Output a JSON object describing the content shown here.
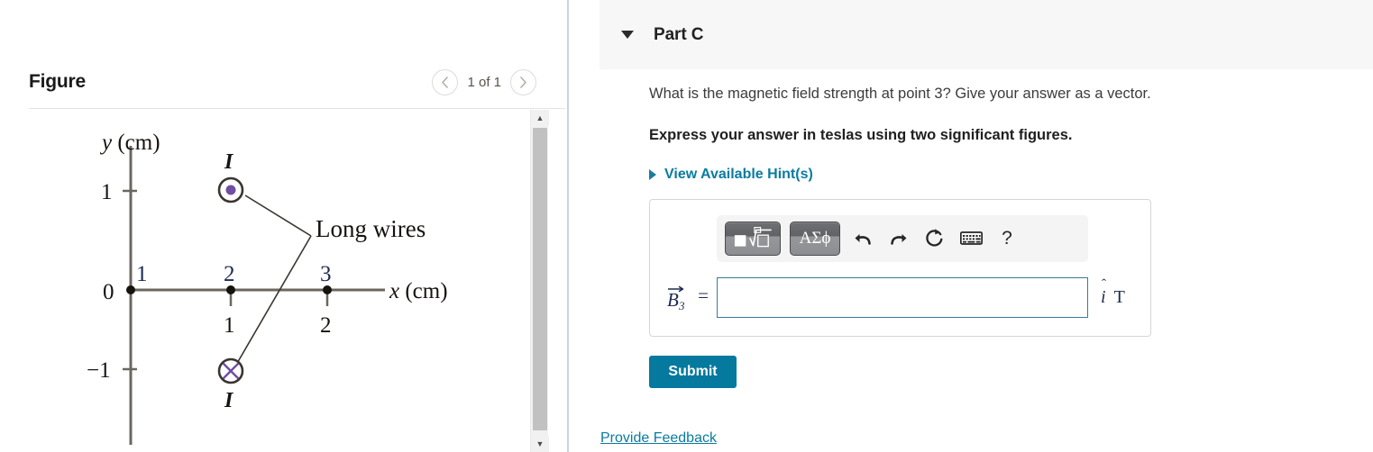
{
  "figure_panel": {
    "title": "Figure",
    "pager": {
      "prev_icon": "chevron-left-icon",
      "label": "1 of 1",
      "next_icon": "chevron-right-icon"
    },
    "scrollbar": {
      "up_arrow": "▲",
      "down_arrow": "▼"
    }
  },
  "chart_data": {
    "type": "diagram",
    "title": "",
    "xlabel": "x (cm)",
    "ylabel": "y (cm)",
    "xlim": [
      -0.35,
      3.6
    ],
    "ylim": [
      -1.85,
      1.6
    ],
    "axis_origin_label": "0",
    "y_ticks": [
      {
        "value": 1,
        "label": "1"
      },
      {
        "value": -1,
        "label": "-1"
      }
    ],
    "x_points": [
      {
        "value": 0,
        "point_label": "1",
        "distance_label": ""
      },
      {
        "value": 1,
        "point_label": "2",
        "distance_label": "1"
      },
      {
        "value": 2,
        "point_label": "3",
        "distance_label": "2"
      }
    ],
    "wires": [
      {
        "name": "current-out-of-page",
        "symbol": "dot",
        "x": 1,
        "y": 1,
        "current_label": "I",
        "color": "#6f4ea3"
      },
      {
        "name": "current-into-page",
        "symbol": "cross",
        "x": 1,
        "y": -1,
        "current_label": "I",
        "color": "#6f4ea3"
      }
    ],
    "annotation": {
      "text": "Long wires",
      "leader_to": [
        "current-out-of-page",
        "current-into-page"
      ]
    },
    "axis_color": "#6b675f",
    "grid": false,
    "legend": "none"
  },
  "part": {
    "toggle_icon": "triangle-down-icon",
    "title": "Part C",
    "question": "What is the magnetic field strength at point 3? Give your answer as a vector.",
    "express_instruction": "Express your answer in teslas using two significant figures.",
    "hints_caret_icon": "triangle-right-icon",
    "hints_label": "View Available Hint(s)"
  },
  "answer": {
    "toolbar": {
      "math_template_button": {
        "name": "math-template-button",
        "label": "√"
      },
      "greek_button": {
        "name": "greek-symbols-button",
        "label": "ΑΣϕ"
      },
      "undo_button": {
        "name": "undo-icon",
        "label": "undo"
      },
      "redo_button": {
        "name": "redo-icon",
        "label": "redo"
      },
      "reset_button": {
        "name": "reset-icon",
        "label": "reset"
      },
      "keyboard_button": {
        "name": "keyboard-icon",
        "label": "keyboard"
      },
      "help_button": {
        "name": "help-icon",
        "label": "?"
      }
    },
    "variable_base": "B",
    "variable_subscript": "3",
    "equals": "=",
    "value": "",
    "placeholder": "",
    "unit_vector": "i",
    "unit": "T"
  },
  "actions": {
    "submit_label": "Submit",
    "provide_feedback_label": "Provide Feedback"
  },
  "colors": {
    "accent_teal": "#05799e",
    "link_teal": "#0a7ba0",
    "header_gray": "#f7f7f7",
    "wire_purple": "#6f4ea3",
    "input_border": "#3a7b96"
  }
}
